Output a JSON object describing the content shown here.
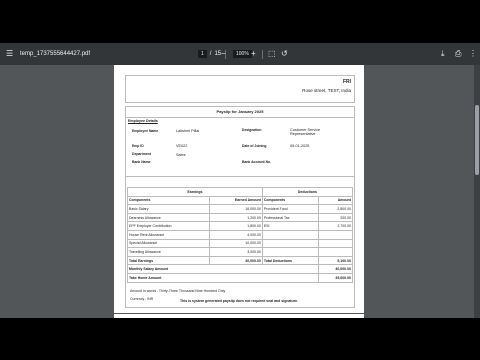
{
  "viewer": {
    "filename": "temp_1737555644427.pdf",
    "page_current": "1",
    "page_sep": "/",
    "page_total": "15",
    "zoom": "100%",
    "zoom_out_label": "−",
    "zoom_in_label": "+"
  },
  "header": {
    "company": "FRI",
    "address": "Rose street, TEST, India"
  },
  "payslip": {
    "title": "Payslip for January 2025",
    "section_employee": "Employee Details",
    "employee_name_label": "Employee Name",
    "employee_name": "Lakshmi Pillai",
    "designation_label": "Designation",
    "designation": "Customer Service Representative",
    "emp_id_label": "Emp ID",
    "emp_id": "VE022",
    "doj_label": "Date of Joining",
    "doj": "05-01-2025",
    "department_label": "Department",
    "department": "Sales",
    "bank_name_label": "Bank Name",
    "bank_account_label": "Bank Account No.",
    "earnings_header": "Earnings",
    "deductions_header": "Deductions",
    "col_components": "Components",
    "col_earned": "Earned Amount",
    "col_components2": "Components",
    "col_amount": "Amount",
    "earnings": [
      {
        "name": "Basic Salary",
        "amount": "16,000.00"
      },
      {
        "name": "Dearness Allowance",
        "amount": "1,200.00"
      },
      {
        "name": "EPF Employer Contribution",
        "amount": "1,800.00"
      },
      {
        "name": "House Rent Allowance",
        "amount": "4,000.00"
      },
      {
        "name": "Special Allowance",
        "amount": "10,000.00"
      },
      {
        "name": "Travelling Allowance",
        "amount": "3,000.00"
      }
    ],
    "deductions": [
      {
        "name": "Provident Fund",
        "amount": "2,800.00"
      },
      {
        "name": "Professional Tax",
        "amount": "200.00"
      },
      {
        "name": "ESI",
        "amount": "2,700.00"
      },
      {
        "name": "",
        "amount": ""
      },
      {
        "name": "",
        "amount": ""
      },
      {
        "name": "",
        "amount": ""
      }
    ],
    "total_earnings_label": "Total Earnings",
    "total_earnings": "40,000.00",
    "total_deductions_label": "Total Deductions",
    "total_deductions": "5,100.00",
    "monthly_salary_label": "Monthly Salary Amount",
    "monthly_salary": "40,000.00",
    "take_home_label": "Take Home Amount",
    "take_home": "35,000.00",
    "amount_words": "Amount in words : Thirty-Three Thousand Nine Hundred Only",
    "currency": "Currency : INR",
    "system_note": "This is system generated payslip does not required seal and signature."
  }
}
